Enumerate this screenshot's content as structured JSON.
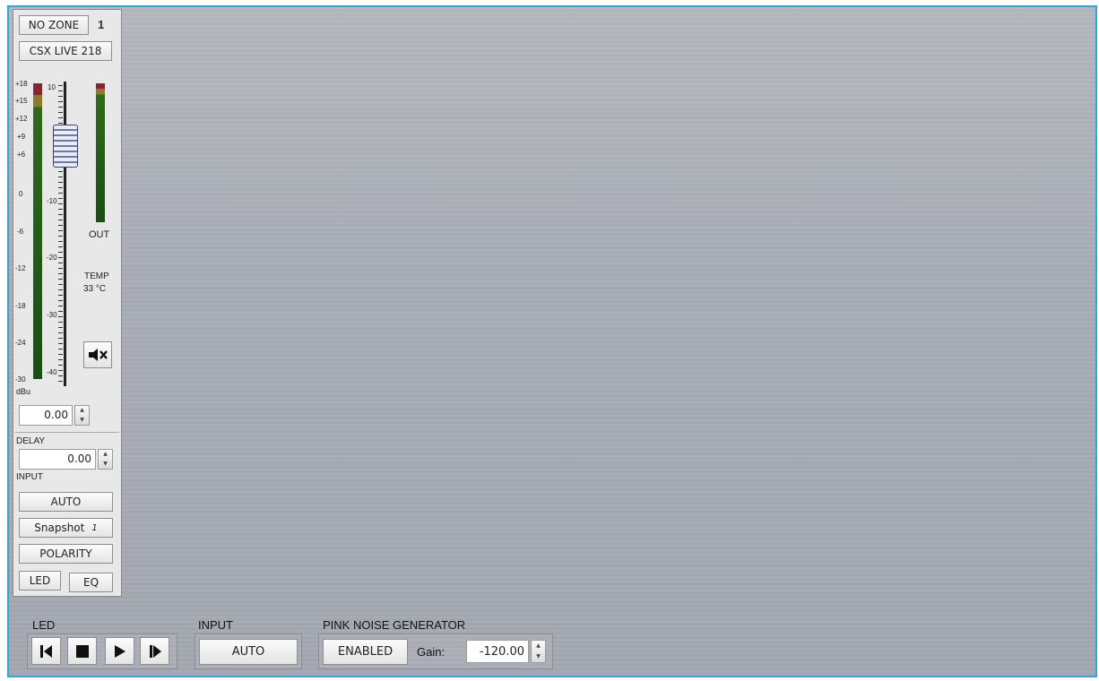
{
  "channel": {
    "zone_label": "NO ZONE",
    "channel_number": "1",
    "model_label": "CSX LIVE 218",
    "meter_scale": [
      "+18",
      "+15",
      "+12",
      "+9",
      "+6",
      "0",
      "-6",
      "-12",
      "-18",
      "-24",
      "-30"
    ],
    "meter_unit": "dBu",
    "fader_scale": [
      "10",
      "-10",
      "-20",
      "-30",
      "-40"
    ],
    "out_label": "OUT",
    "temp_label": "TEMP",
    "temp_value": "33 °C",
    "gain_value": "0.00",
    "delay_label": "DELAY",
    "delay_value": "0.00",
    "input_label": "INPUT",
    "input_button": "AUTO",
    "snapshot_button": "Snapshot",
    "snapshot_number": "1",
    "polarity_button": "POLARITY",
    "led_button": "LED",
    "eq_button": "EQ"
  },
  "bottom": {
    "led_title": "LED",
    "input_title": "INPUT",
    "input_button": "AUTO",
    "pink_title": "PINK NOISE GENERATOR",
    "enabled_button": "ENABLED",
    "gain_label": "Gain:",
    "gain_value": "-120.00"
  },
  "colors": {
    "frame_border": "#33a3e0",
    "meter_red": "#8b2431",
    "meter_yellow": "#8c7b2a",
    "meter_green": "#1a4d14"
  }
}
